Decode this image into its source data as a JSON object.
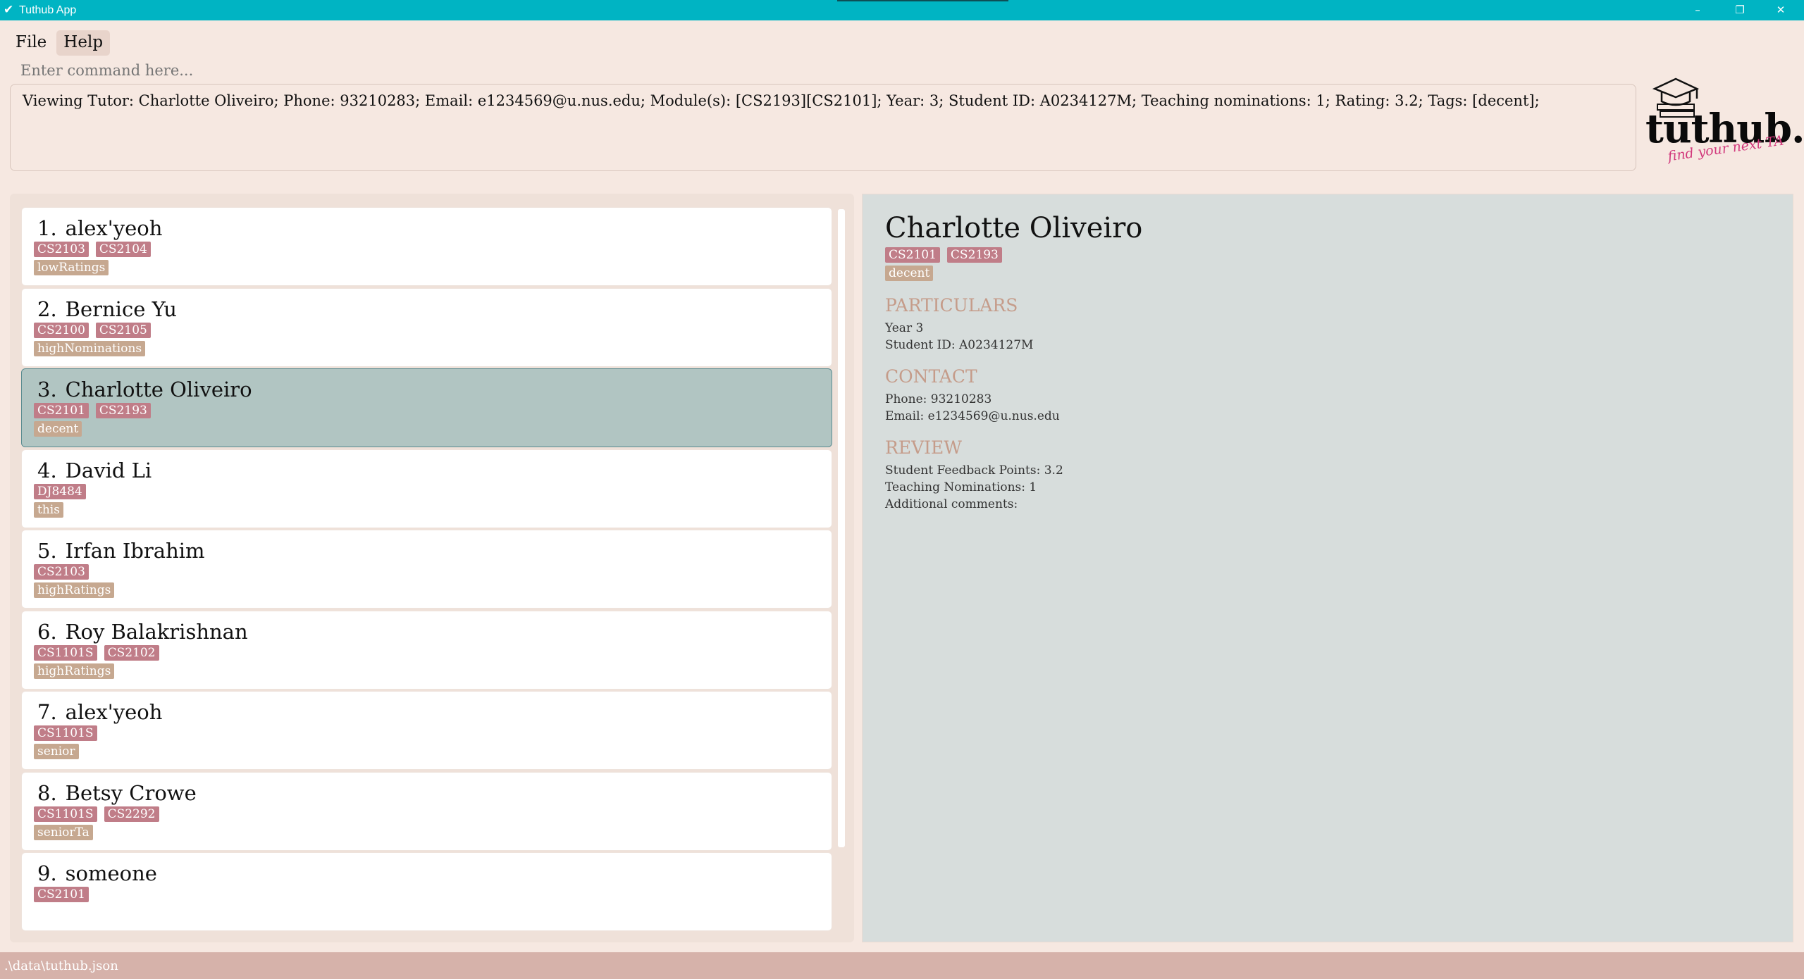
{
  "window": {
    "title": "Tuthub App",
    "icon": "check-icon",
    "controls": {
      "minimize": "–",
      "maximize": "❐",
      "close": "✕"
    }
  },
  "menu": {
    "file": "File",
    "help": "Help"
  },
  "command": {
    "placeholder": "Enter command here..."
  },
  "result": {
    "text": "Viewing Tutor: Charlotte Oliveiro; Phone: 93210283; Email: e1234569@u.nus.edu; Module(s): [CS2193][CS2101]; Year: 3; Student ID: A0234127M; Teaching nominations: 1; Rating: 3.2; Tags: [decent];"
  },
  "logo": {
    "brand": "tuthub.",
    "tagline": "find your next TA"
  },
  "tutors": [
    {
      "index": "1.",
      "name": "alex'yeoh",
      "modules": [
        "CS2103",
        "CS2104"
      ],
      "tags": [
        "lowRatings"
      ]
    },
    {
      "index": "2.",
      "name": "Bernice Yu",
      "modules": [
        "CS2100",
        "CS2105"
      ],
      "tags": [
        "highNominations"
      ]
    },
    {
      "index": "3.",
      "name": "Charlotte Oliveiro",
      "modules": [
        "CS2101",
        "CS2193"
      ],
      "tags": [
        "decent"
      ]
    },
    {
      "index": "4.",
      "name": "David Li",
      "modules": [
        "DJ8484"
      ],
      "tags": [
        "this"
      ]
    },
    {
      "index": "5.",
      "name": "Irfan Ibrahim",
      "modules": [
        "CS2103"
      ],
      "tags": [
        "highRatings"
      ]
    },
    {
      "index": "6.",
      "name": "Roy Balakrishnan",
      "modules": [
        "CS1101S",
        "CS2102"
      ],
      "tags": [
        "highRatings"
      ]
    },
    {
      "index": "7.",
      "name": "alex'yeoh",
      "modules": [
        "CS1101S"
      ],
      "tags": [
        "senior"
      ]
    },
    {
      "index": "8.",
      "name": "Betsy Crowe",
      "modules": [
        "CS1101S",
        "CS2292"
      ],
      "tags": [
        "seniorTa"
      ]
    },
    {
      "index": "9.",
      "name": "someone",
      "modules": [
        "CS2101"
      ],
      "tags": []
    }
  ],
  "detail": {
    "name": "Charlotte Oliveiro",
    "modules": [
      "CS2101",
      "CS2193"
    ],
    "tags": [
      "decent"
    ],
    "particulars_heading": "PARTICULARS",
    "year": "Year 3",
    "student_id": "Student ID: A0234127M",
    "contact_heading": "CONTACT",
    "phone": "Phone: 93210283",
    "email": "Email: e1234569@u.nus.edu",
    "review_heading": "REVIEW",
    "feedback": "Student Feedback Points: 3.2",
    "nominations": "Teaching Nominations: 1",
    "comments": "Additional comments:"
  },
  "status": {
    "path": ".\\data\\tuthub.json"
  },
  "colors": {
    "titlebar": "#00b4c3",
    "background": "#f6e8e1",
    "module_tag": "#c07d88",
    "label_tag": "#c6a890",
    "selected_card": "#b1c5c2",
    "detail_panel": "#d7dddc",
    "section_heading": "#c59c8a",
    "statusbar": "#d6b2aa"
  }
}
